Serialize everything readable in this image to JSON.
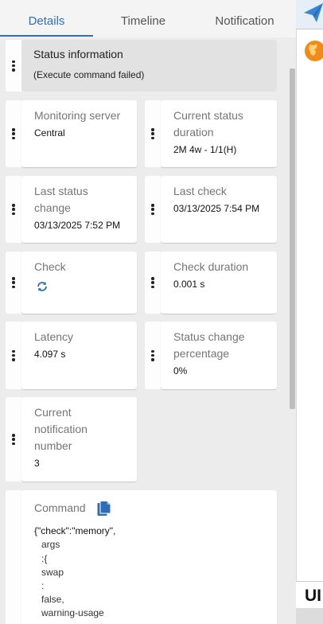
{
  "tabs": [
    {
      "label": "Details",
      "active": true
    },
    {
      "label": "Timeline",
      "active": false
    },
    {
      "label": "Notification",
      "active": false
    }
  ],
  "status": {
    "title": "Status information",
    "message": "(Execute command failed)"
  },
  "cards": {
    "monitoring_server": {
      "label": "Monitoring server",
      "value": "Central"
    },
    "current_status_duration": {
      "label_line1": "Current status",
      "label_line2": "duration",
      "value": "2M 4w - 1/1(H)"
    },
    "last_status_change": {
      "label_line1": "Last status",
      "label_line2": "change",
      "value": "03/13/2025 7:52 PM"
    },
    "last_check": {
      "label": "Last check",
      "value": "03/13/2025 7:54 PM"
    },
    "check": {
      "label": "Check",
      "icon": "refresh-icon"
    },
    "check_duration": {
      "label": "Check duration",
      "value": "0.001 s"
    },
    "latency": {
      "label": "Latency",
      "value": "4.097 s"
    },
    "status_change_percentage": {
      "label_line1": "Status change",
      "label_line2": "percentage",
      "value": "0%"
    },
    "current_notification_number": {
      "label_line1": "Current",
      "label_line2": "notification",
      "label_line3": "number",
      "value": "3"
    }
  },
  "command": {
    "label": "Command",
    "icon": "copy-icon",
    "lines": [
      "{\"check\":\"memory\",",
      "args",
      ":{",
      "swap",
      ":",
      "false,",
      "warning-usage"
    ]
  },
  "right_strip": {
    "text": "UI"
  },
  "colors": {
    "accent": "#2f6eb5",
    "panel_bg": "#ececec",
    "status_bg": "#e2e2e2"
  }
}
